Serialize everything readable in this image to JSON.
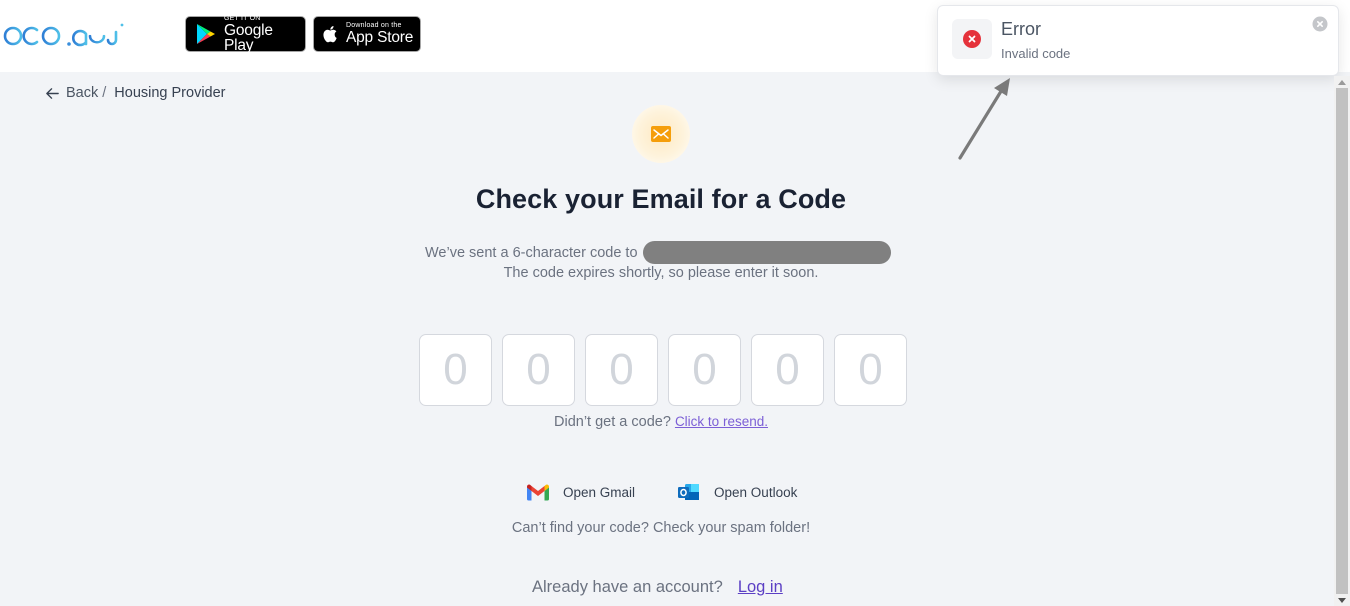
{
  "header": {
    "logo_text": "bob.ai",
    "google_play": {
      "small": "GET IT ON",
      "big": "Google Play"
    },
    "app_store": {
      "small": "Download on the",
      "big": "App Store"
    }
  },
  "breadcrumb": {
    "back_label": "Back",
    "separator": "/",
    "current": "Housing Provider"
  },
  "main": {
    "title": "Check your Email for a Code",
    "sent_prefix": "We’ve sent a 6-character code to",
    "email_redacted": true,
    "expires_text": "The code expires shortly, so please enter it soon.",
    "otp": {
      "length": 6,
      "placeholders": [
        "0",
        "0",
        "0",
        "0",
        "0",
        "0"
      ],
      "values": [
        "",
        "",
        "",
        "",
        "",
        ""
      ]
    },
    "resend_prompt": "Didn’t get a code?",
    "resend_link": "Click to resend.",
    "mail_apps": [
      {
        "label": "Open Gmail",
        "icon": "gmail-icon"
      },
      {
        "label": "Open Outlook",
        "icon": "outlook-icon"
      }
    ],
    "spam_hint": "Can’t find your code? Check your spam folder!",
    "login_prompt": "Already have an account?",
    "login_link": "Log in"
  },
  "toast": {
    "type": "error",
    "title": "Error",
    "message": "Invalid code",
    "icon": "error-circle-icon",
    "color": "#e5323b"
  },
  "colors": {
    "link": "#7c5fd6",
    "login_link": "#5b3fc4",
    "mail_accent": "#f59e0b",
    "background": "#f2f4f7"
  }
}
